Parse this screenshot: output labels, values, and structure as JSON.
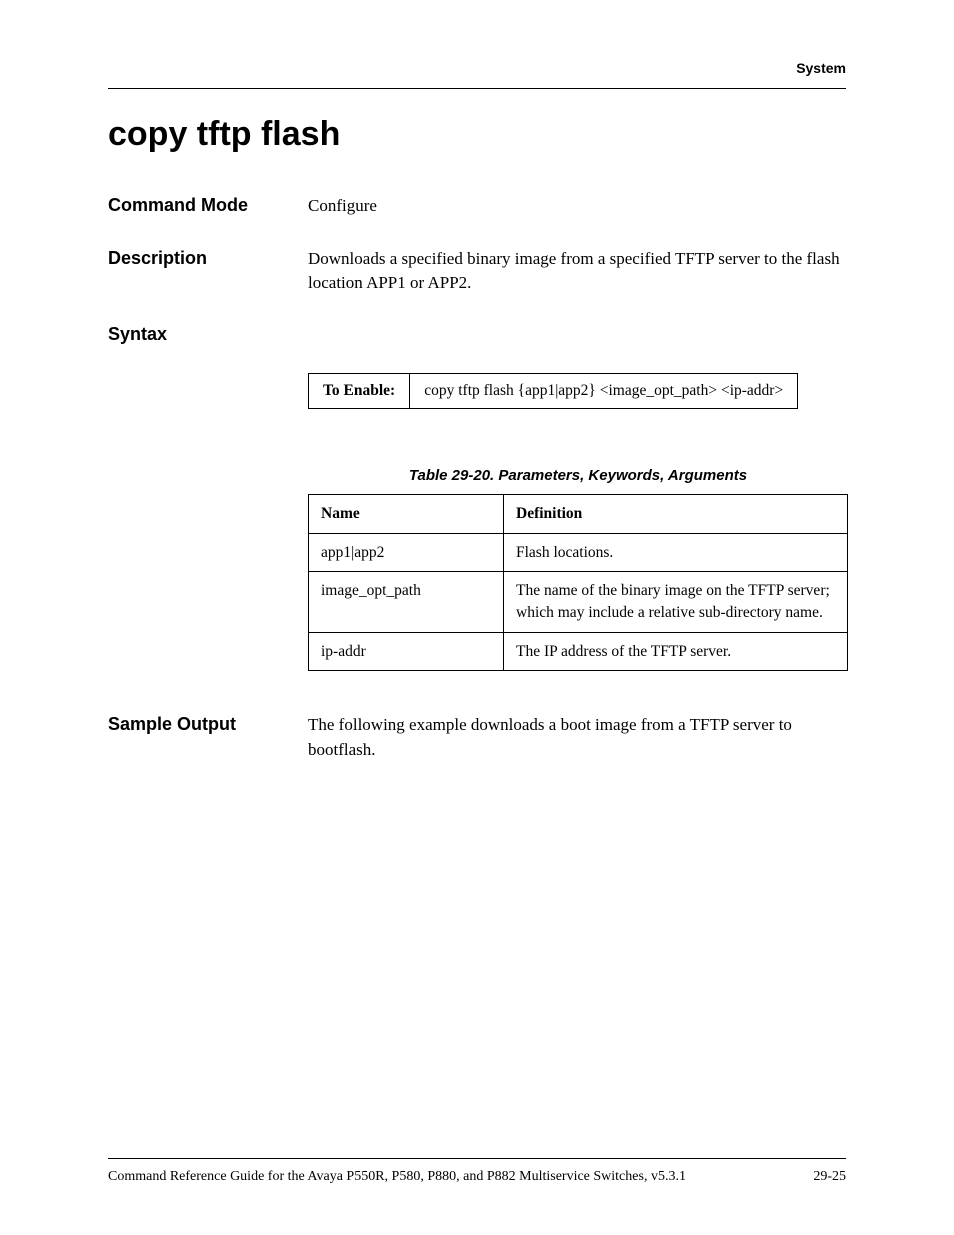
{
  "header": {
    "label": "System"
  },
  "title": "copy tftp flash",
  "sections": {
    "command_mode": {
      "label": "Command Mode",
      "text": "Configure"
    },
    "description": {
      "label": "Description",
      "text": "Downloads a specified binary image from a specified TFTP server to the flash location APP1 or APP2."
    },
    "syntax": {
      "label": "Syntax"
    },
    "sample_output": {
      "label": "Sample Output",
      "text": "The following example downloads a boot image from a TFTP server to bootflash."
    }
  },
  "syntax_row": {
    "label": "To Enable:",
    "command": "copy tftp flash {app1|app2} <image_opt_path> <ip-addr>"
  },
  "param_table": {
    "caption": "Table 29-20.  Parameters, Keywords, Arguments",
    "headers": {
      "name": "Name",
      "definition": "Definition"
    },
    "rows": [
      {
        "name": "app1|app2",
        "definition": "Flash locations."
      },
      {
        "name": "image_opt_path",
        "definition": "The name of the binary image on the TFTP server; which may include a relative sub-directory name."
      },
      {
        "name": "ip-addr",
        "definition": "The IP address of the TFTP server."
      }
    ]
  },
  "footer": {
    "left": "Command Reference Guide for the Avaya P550R, P580, P880, and P882 Multiservice Switches, v5.3.1",
    "right": "29-25"
  }
}
